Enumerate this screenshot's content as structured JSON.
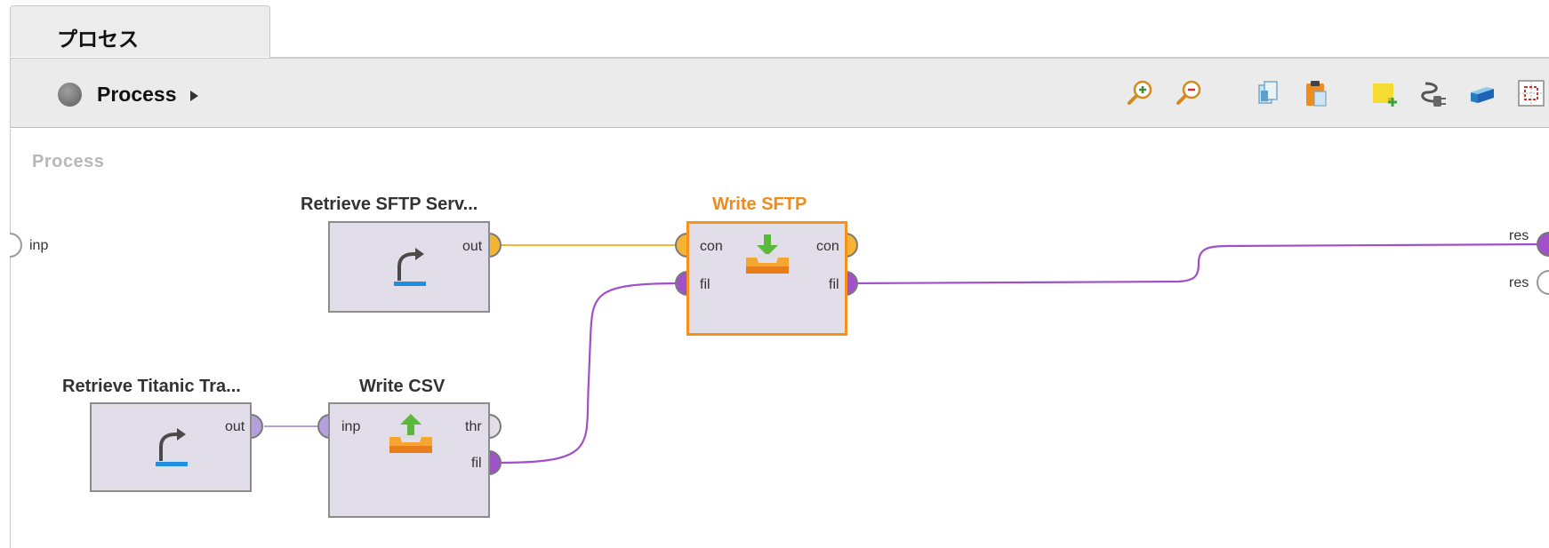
{
  "tab": {
    "label": "プロセス"
  },
  "breadcrumb": {
    "label": "Process"
  },
  "toolbar": {
    "buttons": [
      {
        "name": "zoom-in",
        "icon": "zoom-in-icon"
      },
      {
        "name": "zoom-out",
        "icon": "zoom-out-icon"
      },
      {
        "name": "copy",
        "icon": "copy-icon"
      },
      {
        "name": "paste",
        "icon": "paste-icon"
      },
      {
        "name": "add-note",
        "icon": "add-note-icon"
      },
      {
        "name": "auto-wire",
        "icon": "auto-wire-icon"
      },
      {
        "name": "layers",
        "icon": "layers-icon"
      },
      {
        "name": "fit-to-view",
        "icon": "fit-to-view-icon"
      }
    ]
  },
  "canvas": {
    "title": "Process",
    "left_port": "inp",
    "right_ports": [
      "res",
      "res"
    ],
    "operators": {
      "retrieve_sftp": {
        "name": "Retrieve SFTP Serv...",
        "ports_out": [
          "out"
        ]
      },
      "write_sftp": {
        "name": "Write SFTP",
        "ports_in": [
          "con",
          "fil"
        ],
        "ports_out": [
          "con",
          "fil"
        ],
        "selected": true
      },
      "retrieve_titanic": {
        "name": "Retrieve Titanic Tra...",
        "ports_out": [
          "out"
        ]
      },
      "write_csv": {
        "name": "Write CSV",
        "ports_in": [
          "inp"
        ],
        "ports_out": [
          "thr",
          "fil"
        ]
      }
    }
  },
  "colors": {
    "connection_wire": "#f5b432",
    "file_wire": "#a050c8",
    "data_wire": "#b4a0dc",
    "selected_border": "#f5911e",
    "operator_fill": "#e1dde9"
  }
}
